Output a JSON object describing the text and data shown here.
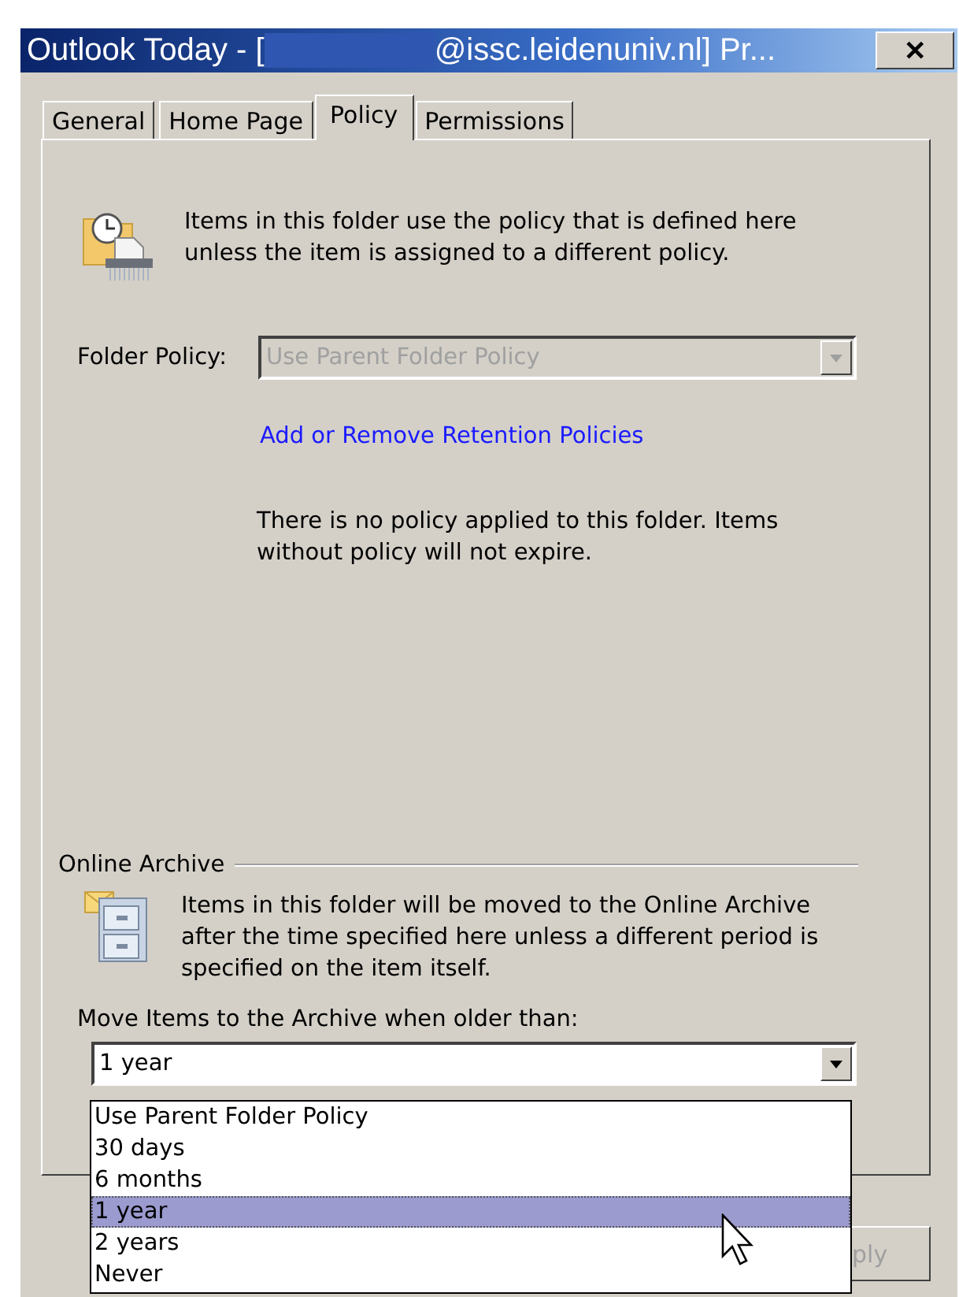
{
  "window": {
    "title_start": "Outlook Today - [",
    "title_redacted": true,
    "title_end": "@issc.leidenuniv.nl] Pr...",
    "close_label": "✕"
  },
  "tabs": [
    {
      "label": "General",
      "selected": false
    },
    {
      "label": "Home Page",
      "selected": false
    },
    {
      "label": "Policy",
      "selected": true
    },
    {
      "label": "Permissions",
      "selected": false
    }
  ],
  "policy": {
    "description": "Items in this folder use the policy that is defined here unless the item is assigned to a different policy.",
    "folder_policy": {
      "label": "Folder Policy:",
      "value": "Use Parent Folder Policy",
      "disabled": true
    },
    "link": "Add or Remove Retention Policies",
    "status": "There is no policy applied to this folder. Items without policy will not expire."
  },
  "online_archive": {
    "heading": "Online Archive",
    "description": "Items in this folder will be moved to the Online Archive after the time specified here unless a different period is specified on the item itself.",
    "move_label": "Move Items to the Archive when older than:",
    "value": "1 year",
    "open": true,
    "options": [
      {
        "label": "Use Parent Folder Policy",
        "selected": false
      },
      {
        "label": "30 days",
        "selected": false
      },
      {
        "label": "6 months",
        "selected": false
      },
      {
        "label": "1 year",
        "selected": true
      },
      {
        "label": "2 years",
        "selected": false
      },
      {
        "label": "Never",
        "selected": false
      }
    ]
  },
  "buttons": [
    {
      "label": "ply",
      "disabled": true
    }
  ]
}
